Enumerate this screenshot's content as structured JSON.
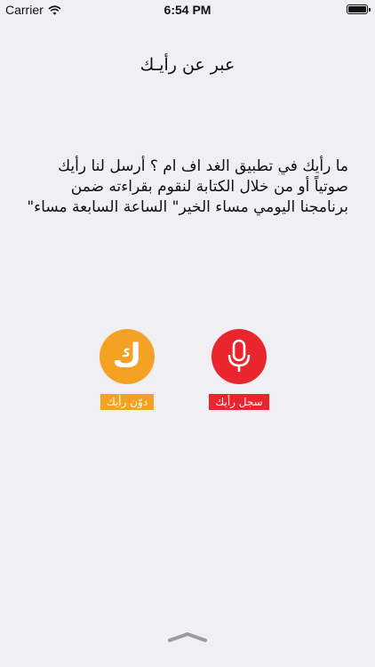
{
  "status_bar": {
    "carrier": "Carrier",
    "time": "6:54 PM"
  },
  "header": {
    "title": "عبر عن رأيـك"
  },
  "main": {
    "question_text": "ما رأيك في تطبيق الغد اف ام ؟ أرسل لنا رأيك صوتياً أو من خلال الكتابة لنقوم بقراءته ضمن برنامجنا اليومي مساء الخير\" الساعة السابعة مساء\""
  },
  "actions": {
    "write": {
      "glyph": "ك",
      "label": "دوّن رأيك",
      "color": "#f4a124"
    },
    "record": {
      "label": "سجل رأيك",
      "color": "#e9262d"
    }
  },
  "icons": {
    "wifi": "wifi-icon",
    "battery": "battery-icon",
    "microphone": "microphone-icon",
    "chevron": "chevron-up-icon"
  }
}
